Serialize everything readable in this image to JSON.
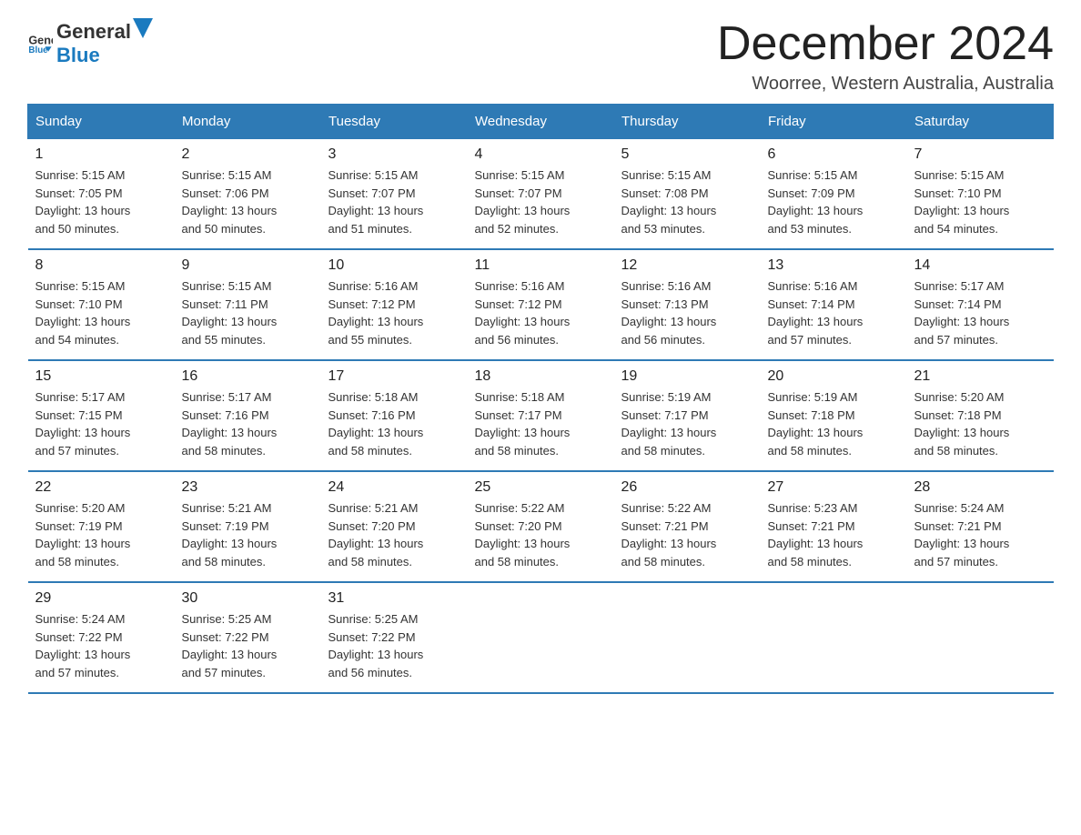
{
  "logo": {
    "general": "General",
    "blue": "Blue"
  },
  "title": "December 2024",
  "subtitle": "Woorree, Western Australia, Australia",
  "days_of_week": [
    "Sunday",
    "Monday",
    "Tuesday",
    "Wednesday",
    "Thursday",
    "Friday",
    "Saturday"
  ],
  "weeks": [
    [
      {
        "day": "1",
        "sunrise": "5:15 AM",
        "sunset": "7:05 PM",
        "daylight": "13 hours and 50 minutes."
      },
      {
        "day": "2",
        "sunrise": "5:15 AM",
        "sunset": "7:06 PM",
        "daylight": "13 hours and 50 minutes."
      },
      {
        "day": "3",
        "sunrise": "5:15 AM",
        "sunset": "7:07 PM",
        "daylight": "13 hours and 51 minutes."
      },
      {
        "day": "4",
        "sunrise": "5:15 AM",
        "sunset": "7:07 PM",
        "daylight": "13 hours and 52 minutes."
      },
      {
        "day": "5",
        "sunrise": "5:15 AM",
        "sunset": "7:08 PM",
        "daylight": "13 hours and 53 minutes."
      },
      {
        "day": "6",
        "sunrise": "5:15 AM",
        "sunset": "7:09 PM",
        "daylight": "13 hours and 53 minutes."
      },
      {
        "day": "7",
        "sunrise": "5:15 AM",
        "sunset": "7:10 PM",
        "daylight": "13 hours and 54 minutes."
      }
    ],
    [
      {
        "day": "8",
        "sunrise": "5:15 AM",
        "sunset": "7:10 PM",
        "daylight": "13 hours and 54 minutes."
      },
      {
        "day": "9",
        "sunrise": "5:15 AM",
        "sunset": "7:11 PM",
        "daylight": "13 hours and 55 minutes."
      },
      {
        "day": "10",
        "sunrise": "5:16 AM",
        "sunset": "7:12 PM",
        "daylight": "13 hours and 55 minutes."
      },
      {
        "day": "11",
        "sunrise": "5:16 AM",
        "sunset": "7:12 PM",
        "daylight": "13 hours and 56 minutes."
      },
      {
        "day": "12",
        "sunrise": "5:16 AM",
        "sunset": "7:13 PM",
        "daylight": "13 hours and 56 minutes."
      },
      {
        "day": "13",
        "sunrise": "5:16 AM",
        "sunset": "7:14 PM",
        "daylight": "13 hours and 57 minutes."
      },
      {
        "day": "14",
        "sunrise": "5:17 AM",
        "sunset": "7:14 PM",
        "daylight": "13 hours and 57 minutes."
      }
    ],
    [
      {
        "day": "15",
        "sunrise": "5:17 AM",
        "sunset": "7:15 PM",
        "daylight": "13 hours and 57 minutes."
      },
      {
        "day": "16",
        "sunrise": "5:17 AM",
        "sunset": "7:16 PM",
        "daylight": "13 hours and 58 minutes."
      },
      {
        "day": "17",
        "sunrise": "5:18 AM",
        "sunset": "7:16 PM",
        "daylight": "13 hours and 58 minutes."
      },
      {
        "day": "18",
        "sunrise": "5:18 AM",
        "sunset": "7:17 PM",
        "daylight": "13 hours and 58 minutes."
      },
      {
        "day": "19",
        "sunrise": "5:19 AM",
        "sunset": "7:17 PM",
        "daylight": "13 hours and 58 minutes."
      },
      {
        "day": "20",
        "sunrise": "5:19 AM",
        "sunset": "7:18 PM",
        "daylight": "13 hours and 58 minutes."
      },
      {
        "day": "21",
        "sunrise": "5:20 AM",
        "sunset": "7:18 PM",
        "daylight": "13 hours and 58 minutes."
      }
    ],
    [
      {
        "day": "22",
        "sunrise": "5:20 AM",
        "sunset": "7:19 PM",
        "daylight": "13 hours and 58 minutes."
      },
      {
        "day": "23",
        "sunrise": "5:21 AM",
        "sunset": "7:19 PM",
        "daylight": "13 hours and 58 minutes."
      },
      {
        "day": "24",
        "sunrise": "5:21 AM",
        "sunset": "7:20 PM",
        "daylight": "13 hours and 58 minutes."
      },
      {
        "day": "25",
        "sunrise": "5:22 AM",
        "sunset": "7:20 PM",
        "daylight": "13 hours and 58 minutes."
      },
      {
        "day": "26",
        "sunrise": "5:22 AM",
        "sunset": "7:21 PM",
        "daylight": "13 hours and 58 minutes."
      },
      {
        "day": "27",
        "sunrise": "5:23 AM",
        "sunset": "7:21 PM",
        "daylight": "13 hours and 58 minutes."
      },
      {
        "day": "28",
        "sunrise": "5:24 AM",
        "sunset": "7:21 PM",
        "daylight": "13 hours and 57 minutes."
      }
    ],
    [
      {
        "day": "29",
        "sunrise": "5:24 AM",
        "sunset": "7:22 PM",
        "daylight": "13 hours and 57 minutes."
      },
      {
        "day": "30",
        "sunrise": "5:25 AM",
        "sunset": "7:22 PM",
        "daylight": "13 hours and 57 minutes."
      },
      {
        "day": "31",
        "sunrise": "5:25 AM",
        "sunset": "7:22 PM",
        "daylight": "13 hours and 56 minutes."
      },
      null,
      null,
      null,
      null
    ]
  ],
  "labels": {
    "sunrise": "Sunrise: ",
    "sunset": "Sunset: ",
    "daylight": "Daylight: "
  },
  "colors": {
    "header_bg": "#2e7ab5",
    "header_text": "#ffffff",
    "border": "#2e7ab5"
  }
}
